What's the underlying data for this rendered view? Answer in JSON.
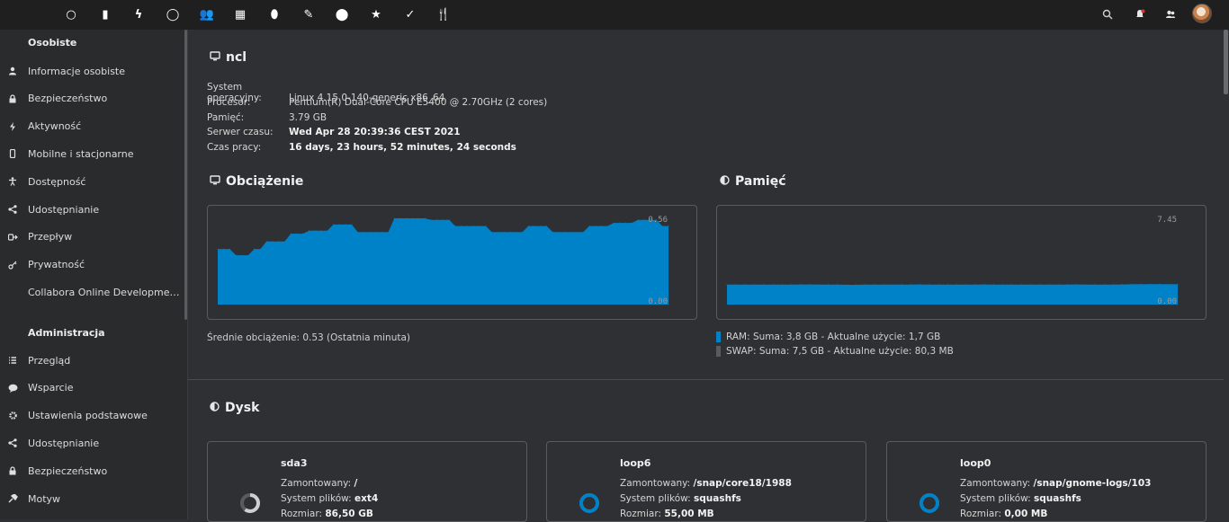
{
  "header": {
    "apps": [
      {
        "name": "dashboard-icon",
        "glyph": "○"
      },
      {
        "name": "files-icon",
        "glyph": "▮"
      },
      {
        "name": "activity-icon",
        "glyph": "ϟ"
      },
      {
        "name": "search-app-icon",
        "glyph": "◯"
      },
      {
        "name": "contacts-icon",
        "glyph": "👥"
      },
      {
        "name": "calendar-icon",
        "glyph": "▦"
      },
      {
        "name": "maps-icon",
        "glyph": "⬮"
      },
      {
        "name": "notes-icon",
        "glyph": "✎"
      },
      {
        "name": "location-icon",
        "glyph": "⬤"
      },
      {
        "name": "star-icon",
        "glyph": "★"
      },
      {
        "name": "tasks-icon",
        "glyph": "✓"
      },
      {
        "name": "cookbook-icon",
        "glyph": "🍴"
      }
    ],
    "right_icons": [
      "search-icon",
      "notifications-icon",
      "contacts-menu-icon"
    ]
  },
  "sidebar": {
    "personal_heading": "Osobiste",
    "personal_items": [
      {
        "label": "Informacje osobiste",
        "icon": "person-icon"
      },
      {
        "label": "Bezpieczeństwo",
        "icon": "lock-icon"
      },
      {
        "label": "Aktywność",
        "icon": "activity-icon"
      },
      {
        "label": "Mobilne i stacjonarne",
        "icon": "phone-icon"
      },
      {
        "label": "Dostępność",
        "icon": "accessibility-icon"
      },
      {
        "label": "Udostępnianie",
        "icon": "share-icon"
      },
      {
        "label": "Przepływ",
        "icon": "flow-icon"
      },
      {
        "label": "Prywatność",
        "icon": "key-icon"
      },
      {
        "label": "Collabora Online Development E…",
        "icon": ""
      }
    ],
    "admin_heading": "Administracja",
    "admin_items": [
      {
        "label": "Przegląd",
        "icon": "list-icon"
      },
      {
        "label": "Wsparcie",
        "icon": "chat-icon"
      },
      {
        "label": "Ustawienia podstawowe",
        "icon": "gear-icon"
      },
      {
        "label": "Udostępnianie",
        "icon": "share-icon"
      },
      {
        "label": "Bezpieczeństwo",
        "icon": "lock-icon"
      },
      {
        "label": "Motyw",
        "icon": "theme-icon"
      }
    ]
  },
  "system": {
    "title": "ncl",
    "rows": [
      {
        "key": "System operacyjny:",
        "value": "Linux 4.15.0-140-generic x86_64",
        "bold": false
      },
      {
        "key": "Procesor:",
        "value": "Pentium(R) Dual-Core CPU E5400 @ 2.70GHz (2 cores)",
        "bold": false
      },
      {
        "key": "Pamięć:",
        "value": "3.79 GB",
        "bold": false
      },
      {
        "key": "Serwer czasu:",
        "value": "Wed Apr 28 20:39:36 CEST 2021",
        "bold": true
      },
      {
        "key": "Czas pracy:",
        "value": "16 days, 23 hours, 52 minutes, 24 seconds",
        "bold": true
      }
    ]
  },
  "load": {
    "title": "Obciążenie",
    "avg_text": "Średnie obciążenie: 0.53 (Ostatnia minuta)"
  },
  "memory": {
    "title": "Pamięć",
    "ram_text": "RAM: Suma: 3,8 GB - Aktualne użycie: 1,7 GB",
    "swap_text": "SWAP: Suma: 7,5 GB - Aktualne użycie: 80,3 MB",
    "ram_color": "#0082c9",
    "swap_color": "#5a5b5e"
  },
  "chart_data": [
    {
      "type": "area",
      "title": "Obciążenie",
      "ylim": [
        0.0,
        0.56
      ],
      "ymax_label": "0.56",
      "ymin_label": "0.00",
      "color": "#0082c9",
      "values": [
        0.36,
        0.36,
        0.36,
        0.32,
        0.32,
        0.32,
        0.36,
        0.36,
        0.41,
        0.41,
        0.41,
        0.41,
        0.46,
        0.46,
        0.46,
        0.48,
        0.48,
        0.48,
        0.48,
        0.52,
        0.52,
        0.52,
        0.52,
        0.47,
        0.47,
        0.47,
        0.47,
        0.47,
        0.47,
        0.56,
        0.56,
        0.56,
        0.56,
        0.56,
        0.56,
        0.55,
        0.55,
        0.55,
        0.55,
        0.51,
        0.51,
        0.51,
        0.51,
        0.51,
        0.51,
        0.47,
        0.47,
        0.47,
        0.47,
        0.47,
        0.47,
        0.51,
        0.51,
        0.51,
        0.51,
        0.47,
        0.47,
        0.47,
        0.47,
        0.47,
        0.47,
        0.51,
        0.51,
        0.51,
        0.51,
        0.53,
        0.53,
        0.53,
        0.53,
        0.55,
        0.55,
        0.55,
        0.55,
        0.51,
        0.51
      ]
    },
    {
      "type": "area",
      "title": "Pamięć",
      "ylim": [
        0.0,
        7.45
      ],
      "ymax_label": "7.45",
      "ymin_label": "0.00",
      "series": [
        {
          "name": "RAM",
          "color": "#0082c9",
          "values": [
            1.72,
            1.72,
            1.73,
            1.73,
            1.72,
            1.72,
            1.73,
            1.73,
            1.74,
            1.74,
            1.73,
            1.72,
            1.72,
            1.71,
            1.71,
            1.72,
            1.73,
            1.73,
            1.72,
            1.72,
            1.73,
            1.74,
            1.73,
            1.72,
            1.72,
            1.72,
            1.73,
            1.73,
            1.74,
            1.73,
            1.72,
            1.72,
            1.73,
            1.73,
            1.72,
            1.72,
            1.73,
            1.73,
            1.74,
            1.73,
            1.72,
            1.72,
            1.73,
            1.74,
            1.75,
            1.75,
            1.76,
            1.76,
            1.75,
            1.75
          ]
        }
      ]
    }
  ],
  "disk": {
    "title": "Dysk",
    "mounted_label": "Zamontowany:",
    "fs_label": "System plików:",
    "size_label": "Rozmiar:",
    "cards": [
      {
        "name": "sda3",
        "mount": "/",
        "fs": "ext4",
        "size": "86,50 GB",
        "ring_color": "#cfcfcf",
        "used": 0.6
      },
      {
        "name": "loop6",
        "mount": "/snap/core18/1988",
        "fs": "squashfs",
        "size": "55,00 MB",
        "ring_color": "#0082c9",
        "used": 1.0
      },
      {
        "name": "loop0",
        "mount": "/snap/gnome-logs/103",
        "fs": "squashfs",
        "size": "0,00 MB",
        "ring_color": "#0082c9",
        "used": 1.0
      }
    ]
  }
}
